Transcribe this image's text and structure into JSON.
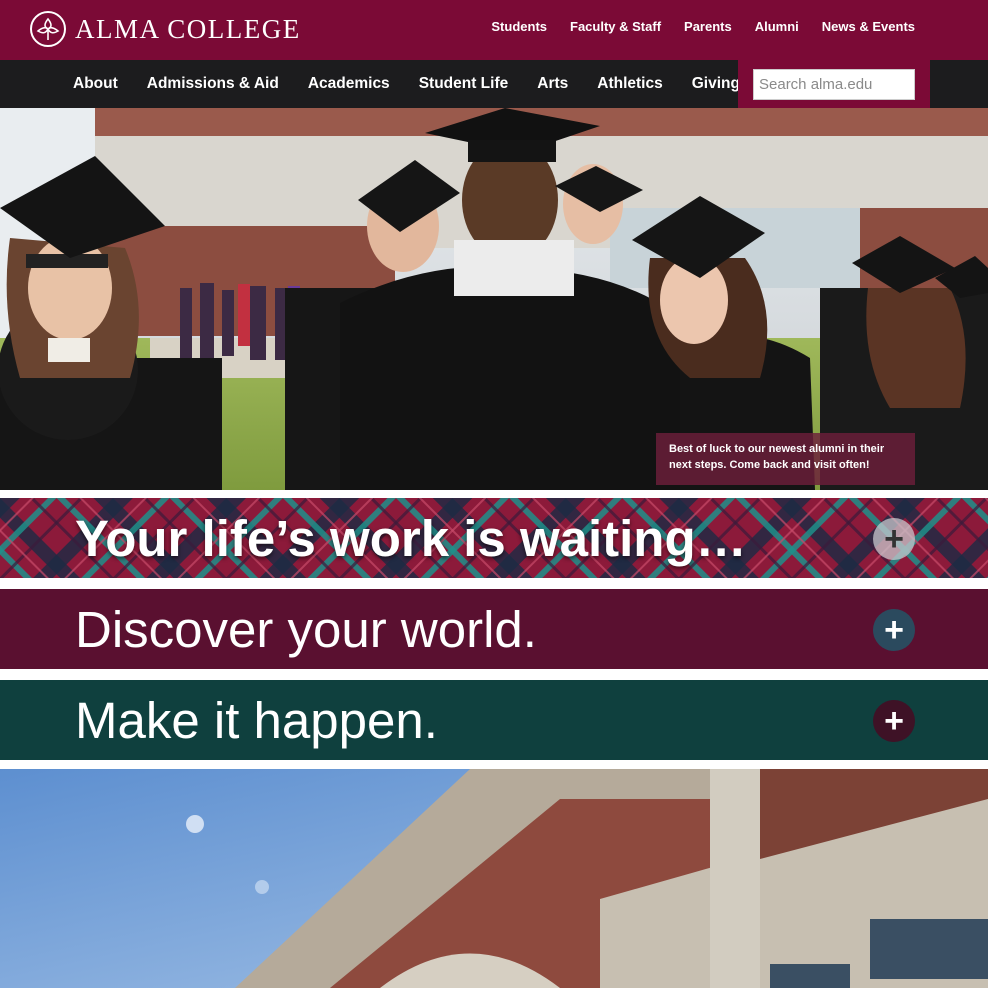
{
  "header": {
    "logo_text": "ALMA COLLEGE",
    "top_links": [
      "Students",
      "Faculty & Staff",
      "Parents",
      "Alumni",
      "News & Events"
    ]
  },
  "nav": {
    "items": [
      "About",
      "Admissions & Aid",
      "Academics",
      "Student Life",
      "Arts",
      "Athletics",
      "Giving"
    ]
  },
  "search": {
    "placeholder": "Search alma.edu"
  },
  "hero": {
    "caption": "Best of luck to our newest alumni in their next steps. Come back and visit often!"
  },
  "banners": [
    {
      "text": "Your life’s work is waiting…",
      "plus": "+"
    },
    {
      "text": "Discover your world.",
      "plus": "+"
    },
    {
      "text": "Make it happen.",
      "plus": "+"
    }
  ],
  "colors": {
    "brand_maroon": "#7b0a36",
    "nav_dark": "#1c1c1e",
    "banner_maroon": "#5a1030",
    "banner_teal": "#0f403e"
  }
}
